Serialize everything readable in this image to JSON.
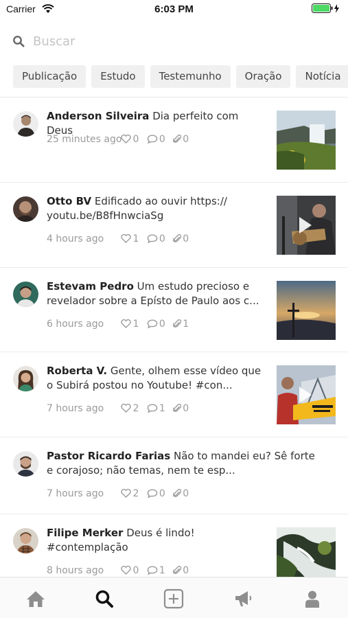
{
  "status_bar": {
    "carrier": "Carrier",
    "time": "6:03 PM"
  },
  "search": {
    "placeholder": "Buscar",
    "icon": "search-icon"
  },
  "categories": [
    "Publicação",
    "Estudo",
    "Testemunho",
    "Oração",
    "Notícia"
  ],
  "posts": [
    {
      "author": "Anderson Silveira",
      "text": "Dia perfeito com Deus",
      "time": "25 minutes ago",
      "likes": "0",
      "comments": "0",
      "attachments": "0",
      "thumbnail": "waterfall-landscape"
    },
    {
      "author": "Otto BV",
      "text": "Edificado ao ouvir https:// youtu.be/B8fHnwciaSg",
      "time": "4 hours ago",
      "likes": "1",
      "comments": "0",
      "attachments": "0",
      "thumbnail": "video-guitar-player"
    },
    {
      "author": "Estevam Pedro",
      "text": "Um estudo precioso e revelador sobre a Epísto de Paulo aos c...",
      "time": "6 hours ago",
      "likes": "1",
      "comments": "0",
      "attachments": "1",
      "thumbnail": "cross-sunset"
    },
    {
      "author": "Roberta V.",
      "text": "Gente, olhem esse vídeo que o Subirá postou no Youtube! #con...",
      "time": "7 hours ago",
      "likes": "2",
      "comments": "1",
      "attachments": "0",
      "thumbnail": "video-speaker"
    },
    {
      "author": "Pastor Ricardo Farias",
      "text": "Não to mandei eu? Sê forte e corajoso; não temas, nem te esp...",
      "time": "7 hours ago",
      "likes": "2",
      "comments": "0",
      "attachments": "0",
      "thumbnail": ""
    },
    {
      "author": "Filipe Merker",
      "text": "Deus é lindo! #contemplação",
      "time": "8 hours ago",
      "likes": "0",
      "comments": "1",
      "attachments": "0",
      "thumbnail": "waterfall-rocks"
    }
  ],
  "tabbar": {
    "items": [
      "home-icon",
      "search-icon",
      "add-post-icon",
      "megaphone-icon",
      "profile-icon"
    ],
    "active_color": "#111111",
    "inactive_color": "#8e8e8e"
  },
  "colors": {
    "battery": "#4cd964",
    "chip_bg": "#f0f0f0"
  }
}
